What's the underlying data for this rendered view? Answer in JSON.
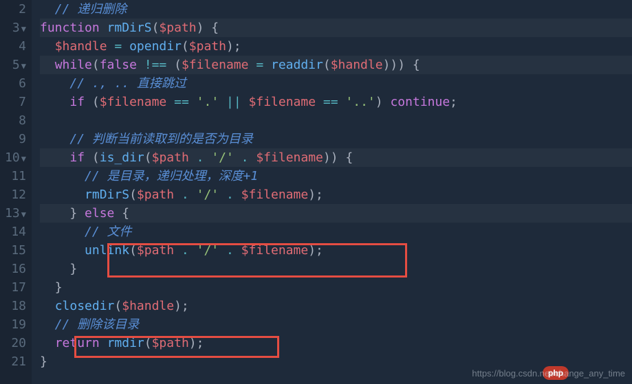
{
  "gutter": [
    "2",
    "3",
    "4",
    "5",
    "6",
    "7",
    "8",
    "9",
    "10",
    "11",
    "12",
    "13",
    "14",
    "15",
    "16",
    "17",
    "18",
    "19",
    "20",
    "21"
  ],
  "fold_markers": {
    "1": "▼",
    "3": "▼",
    "8": "▼",
    "11": "▼"
  },
  "lines": {
    "l2": {
      "indent": "  ",
      "comment": "// 递归删除"
    },
    "l3": {
      "kw": "function",
      "name": "rmDirS",
      "open": "(",
      "var": "$path",
      "close": ")",
      "brace": " {"
    },
    "l4": {
      "indent": "  ",
      "var1": "$handle",
      "eq": " = ",
      "fn": "opendir",
      "open": "(",
      "var2": "$path",
      "close": ");"
    },
    "l5": {
      "indent": "  ",
      "kw": "while",
      "open": "(",
      "false": "false",
      "neq": " !== ",
      "open2": "(",
      "var1": "$filename",
      "eq": " = ",
      "fn": "readdir",
      "open3": "(",
      "var2": "$handle",
      "close": ")))",
      "brace": " {"
    },
    "l6": {
      "indent": "    ",
      "comment": "// ., .. 直接跳过"
    },
    "l7": {
      "indent": "    ",
      "kw": "if",
      "open": " (",
      "var1": "$filename",
      "eq": " == ",
      "s1": "'.'",
      "or": " || ",
      "var2": "$filename",
      "eq2": " == ",
      "s2": "'..'",
      "close": ") ",
      "cont": "continue",
      "semi": ";"
    },
    "l8": {
      "blank": ""
    },
    "l9": {
      "indent": "    ",
      "comment": "// 判断当前读取到的是否为目录"
    },
    "l10": {
      "indent": "    ",
      "kw": "if",
      "open": " (",
      "fn": "is_dir",
      "open2": "(",
      "var1": "$path",
      "cat": " . ",
      "s1": "'/'",
      "cat2": " . ",
      "var2": "$filename",
      "close": "))",
      "brace": " {"
    },
    "l11": {
      "indent": "      ",
      "comment": "// 是目录，递归处理，深度+1"
    },
    "l12": {
      "indent": "      ",
      "fn": "rmDirS",
      "open": "(",
      "var1": "$path",
      "cat": " . ",
      "s1": "'/'",
      "cat2": " . ",
      "var2": "$filename",
      "close": ");"
    },
    "l13": {
      "indent": "    ",
      "brace": "}",
      "kw": " else ",
      "brace2": "{"
    },
    "l14": {
      "indent": "      ",
      "comment": "// 文件"
    },
    "l15": {
      "indent": "      ",
      "fn": "unlink",
      "open": "(",
      "var1": "$path",
      "cat": " . ",
      "s1": "'/'",
      "cat2": " . ",
      "var2": "$filename",
      "close": ");"
    },
    "l16": {
      "indent": "    ",
      "brace": "}"
    },
    "l17": {
      "indent": "  ",
      "brace": "}"
    },
    "l18": {
      "indent": "  ",
      "fn": "closedir",
      "open": "(",
      "var1": "$handle",
      "close": ");"
    },
    "l19": {
      "indent": "  ",
      "comment": "// 删除该目录"
    },
    "l20": {
      "indent": "  ",
      "kw": "return",
      "sp": " ",
      "fn": "rmdir",
      "open": "(",
      "var1": "$path",
      "close": ");"
    },
    "l21": {
      "brace": "}"
    }
  },
  "watermark": "https://blog.csdn.net/change_any_time",
  "logo": "php"
}
